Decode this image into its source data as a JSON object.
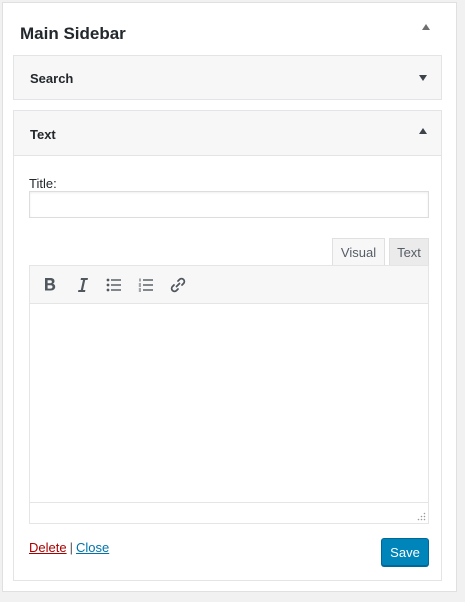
{
  "sidebar": {
    "title": "Main Sidebar",
    "toggle_icon": "caret-up-icon"
  },
  "widgets": {
    "search": {
      "title": "Search",
      "toggle_icon": "caret-down-icon"
    },
    "text": {
      "title": "Text",
      "toggle_icon": "caret-up-icon",
      "title_field": {
        "label": "Title:",
        "value": "",
        "placeholder": ""
      },
      "editor_tabs": [
        "Visual",
        "Text"
      ],
      "active_tab": "Visual",
      "toolbar": {
        "buttons": [
          "bold-icon",
          "italic-icon",
          "bulleted-list-icon",
          "numbered-list-icon",
          "link-icon"
        ]
      },
      "content": "",
      "delete_label": "Delete",
      "separator": "|",
      "close_label": "Close",
      "save_label": "Save"
    }
  },
  "colors": {
    "accent": "#0085ba",
    "delete_link": "#aa0000",
    "close_link": "#0073aa"
  }
}
